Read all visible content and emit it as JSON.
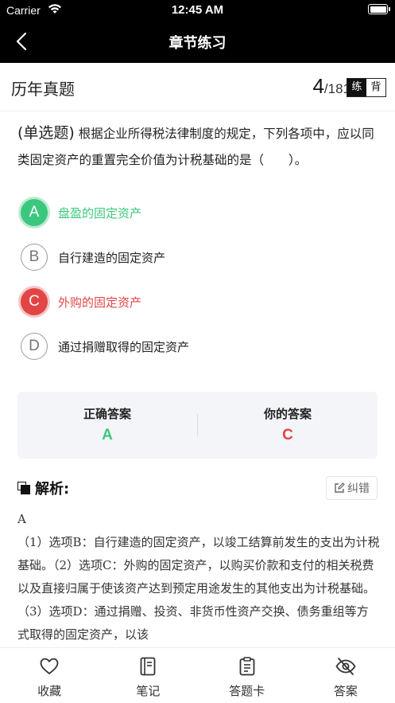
{
  "status_bar": {
    "carrier": "Carrier",
    "time": "12:45 AM"
  },
  "nav": {
    "title": "章节练习"
  },
  "header": {
    "section_title": "历年真题",
    "current": "4",
    "total": "/181",
    "mode_practice": "练",
    "mode_memorize": "背"
  },
  "question": {
    "type": "(单选题)",
    "text": "根据企业所得税法律制度的规定，下列各项中，应以同类固定资产的重置完全价值为计税基础的是（　　）。"
  },
  "options": [
    {
      "letter": "A",
      "text": "盘盈的固定资产",
      "state": "correct"
    },
    {
      "letter": "B",
      "text": "自行建造的固定资产",
      "state": "plain"
    },
    {
      "letter": "C",
      "text": "外购的固定资产",
      "state": "wrong"
    },
    {
      "letter": "D",
      "text": "通过捐赠取得的固定资产",
      "state": "plain"
    }
  ],
  "answers": {
    "correct_label": "正确答案",
    "correct_value": "A",
    "yours_label": "你的答案",
    "yours_value": "C"
  },
  "analysis": {
    "title": "解析:",
    "report_label": "纠错",
    "answer": "A",
    "text": "（1）选项B：自行建造的固定资产，以竣工结算前发生的支出为计税基础。（2）选项C：外购的固定资产，以购买价款和支付的相关税费以及直接归属于使该资产达到预定用途发生的其他支出为计税基础。（3）选项D：通过捐赠、投资、非货币性资产交换、债务重组等方式取得的固定资产，以该"
  },
  "tabs": [
    {
      "label": "收藏",
      "icon": "heart-icon"
    },
    {
      "label": "笔记",
      "icon": "notebook-icon"
    },
    {
      "label": "答题卡",
      "icon": "answer-sheet-icon"
    },
    {
      "label": "答案",
      "icon": "eye-off-icon"
    }
  ],
  "colors": {
    "correct": "#3cc77e",
    "wrong": "#e24545",
    "nav_bg": "#000000"
  }
}
